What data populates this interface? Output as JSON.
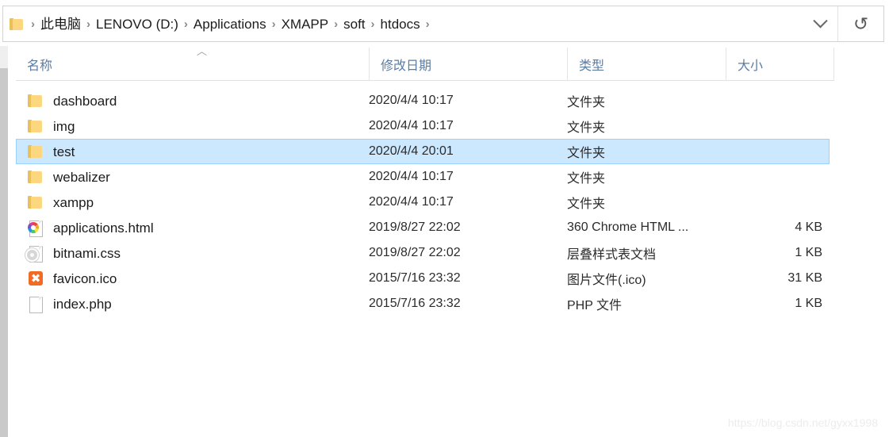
{
  "address_bar": {
    "folder_icon": "folder-icon",
    "separator": "›",
    "crumbs": [
      {
        "label": "此电脑"
      },
      {
        "label": "LENOVO (D:)"
      },
      {
        "label": "Applications"
      },
      {
        "label": "XMAPP"
      },
      {
        "label": "soft"
      },
      {
        "label": "htdocs"
      }
    ],
    "dropdown_icon": "chevron-down-icon",
    "refresh_icon": "refresh-icon",
    "refresh_glyph": "↻"
  },
  "columns": {
    "name": "名称",
    "date_modified": "修改日期",
    "type": "类型",
    "size": "大小",
    "sort_caret": "︿",
    "sort_direction": "ascending",
    "sort_column": "名称"
  },
  "files": [
    {
      "name": "dashboard",
      "date": "2020/4/4 10:17",
      "type": "文件夹",
      "size": "",
      "icon": "folder-icon",
      "selected": false
    },
    {
      "name": "img",
      "date": "2020/4/4 10:17",
      "type": "文件夹",
      "size": "",
      "icon": "folder-icon",
      "selected": false
    },
    {
      "name": "test",
      "date": "2020/4/4 20:01",
      "type": "文件夹",
      "size": "",
      "icon": "folder-icon",
      "selected": true
    },
    {
      "name": "webalizer",
      "date": "2020/4/4 10:17",
      "type": "文件夹",
      "size": "",
      "icon": "folder-icon",
      "selected": false
    },
    {
      "name": "xampp",
      "date": "2020/4/4 10:17",
      "type": "文件夹",
      "size": "",
      "icon": "folder-icon",
      "selected": false
    },
    {
      "name": "applications.html",
      "date": "2019/8/27 22:02",
      "type": "360 Chrome HTML ...",
      "size": "4 KB",
      "icon": "chrome-html-document-icon",
      "selected": false
    },
    {
      "name": "bitnami.css",
      "date": "2019/8/27 22:02",
      "type": "层叠样式表文档",
      "size": "1 KB",
      "icon": "stylesheet-document-icon",
      "selected": false
    },
    {
      "name": "favicon.ico",
      "date": "2015/7/16 23:32",
      "type": "图片文件(.ico)",
      "size": "31 KB",
      "icon": "xampp-icon",
      "selected": false
    },
    {
      "name": "index.php",
      "date": "2015/7/16 23:32",
      "type": "PHP 文件",
      "size": "1 KB",
      "icon": "blank-document-icon",
      "selected": false
    }
  ],
  "watermark": {
    "text": "https://blog.csdn.net/gyxx1998"
  },
  "colors": {
    "selection_background": "#cce8ff",
    "selection_border": "#99d1ff",
    "header_text": "#5b7da3",
    "folder_yellow": "#fcd77f",
    "xampp_orange": "#f06c24"
  }
}
